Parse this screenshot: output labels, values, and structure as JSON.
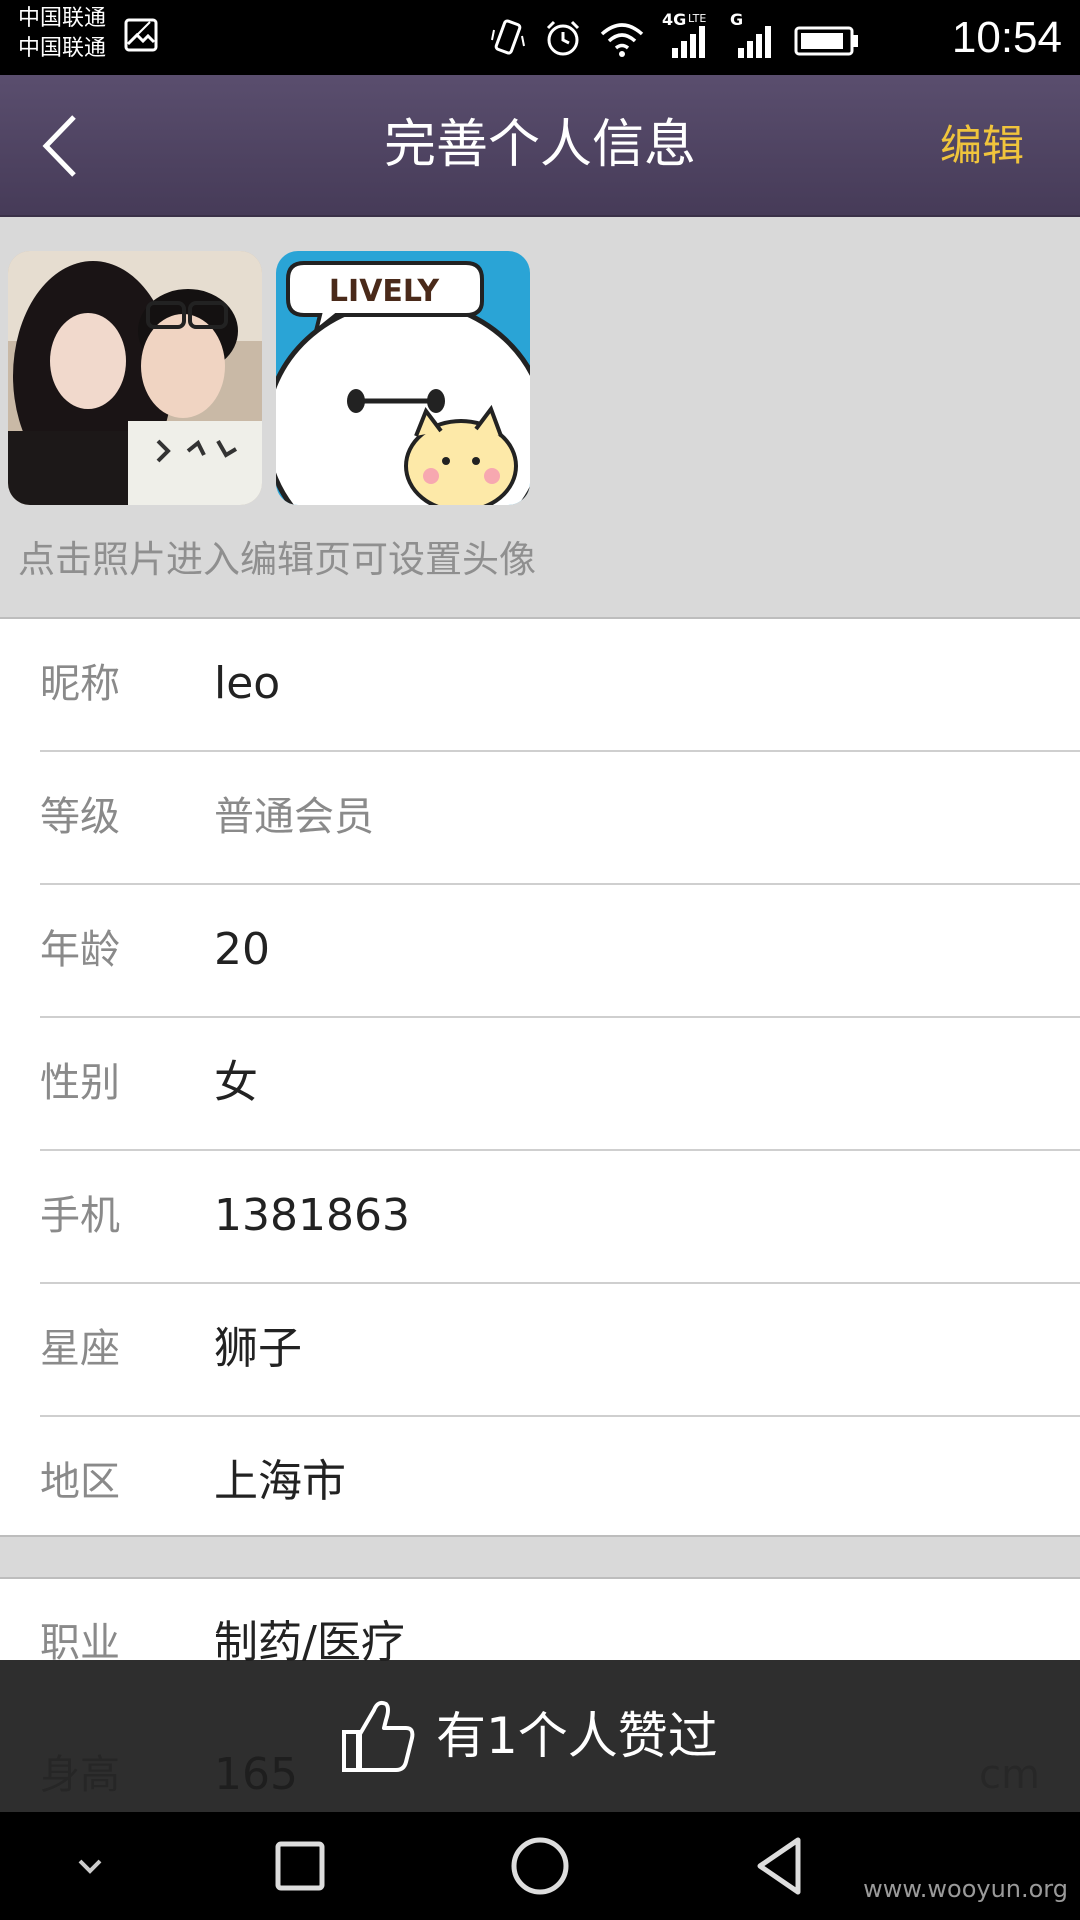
{
  "status_bar": {
    "carrier_1": "中国联通",
    "carrier_2": "中国联通",
    "network_label": "4G",
    "network_sub": "LTE",
    "network2_label": "G",
    "time": "10:54"
  },
  "header": {
    "title": "完善个人信息",
    "edit_label": "编辑",
    "accent_color": "#f0c43c"
  },
  "photos": {
    "hint": "点击照片进入编辑页可设置头像",
    "photo_2_text": "LIVELY"
  },
  "profile": {
    "rows": [
      {
        "label": "昵称",
        "value": "leo"
      },
      {
        "label": "等级",
        "value": "普通会员"
      },
      {
        "label": "年龄",
        "value": "20"
      },
      {
        "label": "性别",
        "value": "女"
      },
      {
        "label": "手机",
        "value": "1381863"
      },
      {
        "label": "星座",
        "value": "狮子"
      },
      {
        "label": "地区",
        "value": "上海市"
      }
    ],
    "job": {
      "label": "职业",
      "value": "制药/医疗"
    },
    "height": {
      "label": "身高",
      "value": "165",
      "unit": "cm"
    }
  },
  "likebar": {
    "text": "有1个人赞过"
  },
  "watermark": "www.wooyun.org"
}
